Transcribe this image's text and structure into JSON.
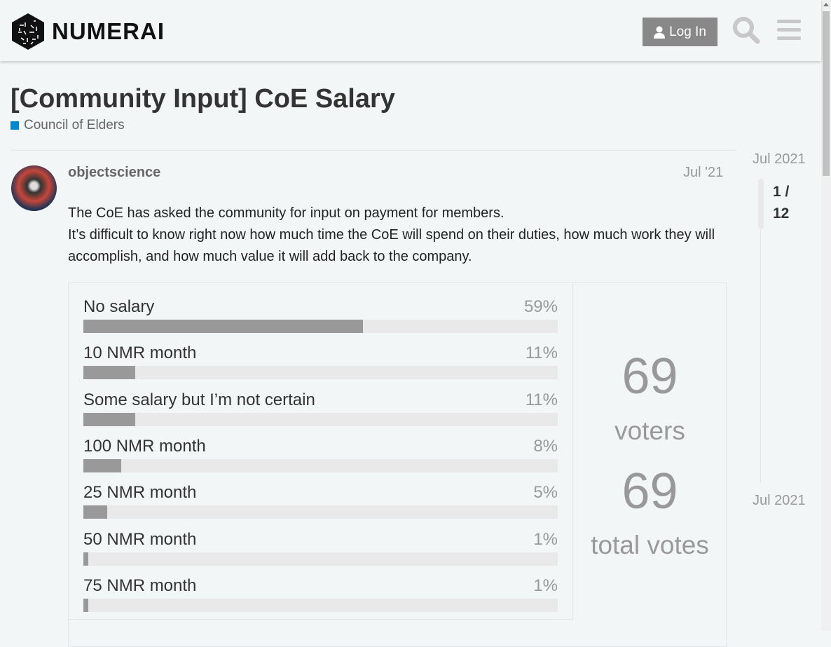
{
  "header": {
    "brand": "NUMERAI",
    "login_label": "Log In"
  },
  "topic": {
    "title": "[Community Input] CoE Salary",
    "category": "Council of Elders",
    "category_color": "#0088cc"
  },
  "post": {
    "username": "objectscience",
    "date": "Jul '21",
    "paragraphs": [
      "The CoE has asked the community for input on payment for members.",
      "It’s difficult to know right now how much time the CoE will spend on their duties, how much work they will accomplish, and how much value it will add back to the company."
    ]
  },
  "poll": {
    "options": [
      {
        "label": "No salary",
        "percent": 59
      },
      {
        "label": "10 NMR month",
        "percent": 11
      },
      {
        "label": "Some salary but I’m not certain",
        "percent": 11
      },
      {
        "label": "100 NMR month",
        "percent": 8
      },
      {
        "label": "25 NMR month",
        "percent": 5
      },
      {
        "label": "50 NMR month",
        "percent": 1
      },
      {
        "label": "75 NMR month",
        "percent": 1
      }
    ],
    "voters": "69",
    "voters_label": "voters",
    "total_votes": "69",
    "total_votes_label": "total votes"
  },
  "timeline": {
    "start": "Jul 2021",
    "position": "1 /",
    "total": "12",
    "end": "Jul 2021"
  }
}
